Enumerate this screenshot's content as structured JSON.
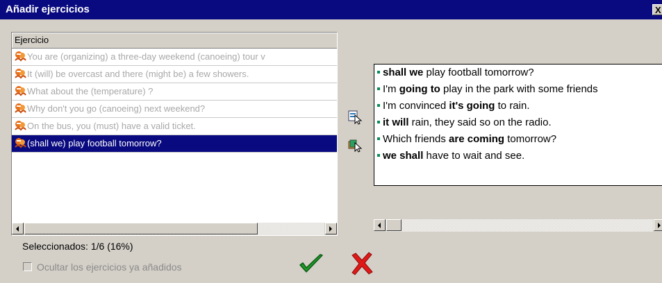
{
  "window": {
    "title": "Añadir ejercicios",
    "close_label": "X"
  },
  "list": {
    "column_header": "Ejercicio",
    "rows": [
      {
        "text": "You are (organizing) a three-day weekend (canoeing) tour v",
        "selected": false
      },
      {
        "text": "It (will) be overcast and there (might be) a few showers.",
        "selected": false
      },
      {
        "text": "What about the (temperature) ?",
        "selected": false
      },
      {
        "text": "Why don't you go (canoeing) next weekend?",
        "selected": false
      },
      {
        "text": "On the bus, you (must) have a valid ticket.",
        "selected": false
      },
      {
        "text": "(shall we) play football tomorrow?",
        "selected": true
      }
    ]
  },
  "preview": {
    "sentences": [
      {
        "bold": "shall we",
        "rest": " play football tomorrow?",
        "pre": ""
      },
      {
        "pre": "I'm ",
        "bold": "going to",
        "rest": " play in the park with some friends"
      },
      {
        "pre": "I'm convinced ",
        "bold": "it's going",
        "rest": " to rain."
      },
      {
        "pre": "",
        "bold": "it will",
        "rest": " rain, they said so on the radio."
      },
      {
        "pre": "Which friends ",
        "bold": "are coming",
        "rest": " tomorrow?"
      },
      {
        "pre": "",
        "bold": "we shall",
        "rest": " have to wait and see."
      }
    ]
  },
  "footer": {
    "status": "Seleccionados: 1/6 (16%)",
    "hide_added_label": "Ocultar los ejercicios ya añadidos"
  },
  "icons": {
    "row_icon": "exercise-icon",
    "tool_1": "add-to-list-icon",
    "tool_2": "add-all-icon",
    "ok": "checkmark-icon",
    "cancel": "cross-icon"
  },
  "colors": {
    "title_bar": "#0a0a80",
    "selection": "#0a0a80",
    "ok": "#1f9a2a",
    "cancel": "#e01818",
    "bullet": "#0a8a55"
  }
}
